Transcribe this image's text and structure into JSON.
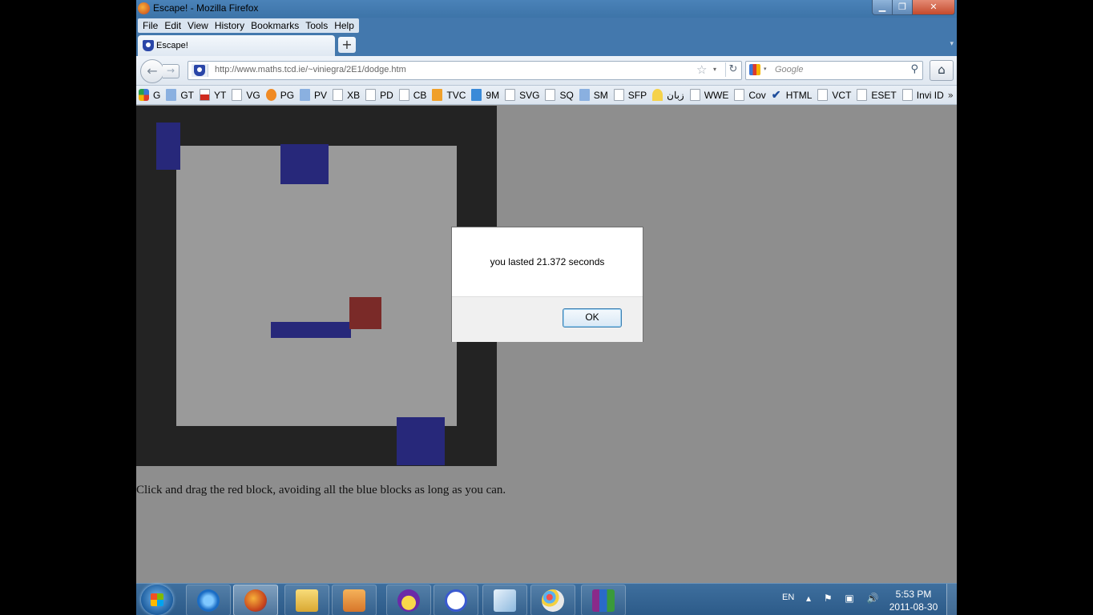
{
  "window": {
    "title": "Escape! - Mozilla Firefox",
    "controls": {
      "minimize": "▁",
      "maximize": "❐",
      "close": "✕"
    }
  },
  "menu": [
    "File",
    "Edit",
    "View",
    "History",
    "Bookmarks",
    "Tools",
    "Help"
  ],
  "tab": {
    "title": "Escape!",
    "new_tab": "+",
    "list": "▾"
  },
  "nav": {
    "back": "←",
    "forward": "→",
    "url": "http://www.maths.tcd.ie/~viniegra/2E1/dodge.htm",
    "star": "☆",
    "dropdown": "▾",
    "reload": "↻",
    "search_placeholder": "Google",
    "search_dropdown": "▾",
    "search_glyph": "⚲",
    "home": "⌂"
  },
  "bookmarks": [
    {
      "label": "G",
      "icon": "g"
    },
    {
      "label": "GT",
      "icon": "gt"
    },
    {
      "label": "YT",
      "icon": "yt"
    },
    {
      "label": "VG",
      "icon": "page"
    },
    {
      "label": "PG",
      "icon": "orange"
    },
    {
      "label": "PV",
      "icon": "gt"
    },
    {
      "label": "XB",
      "icon": "page"
    },
    {
      "label": "PD",
      "icon": "page"
    },
    {
      "label": "CB",
      "icon": "page"
    },
    {
      "label": "TVC",
      "icon": "tv"
    },
    {
      "label": "9M",
      "icon": "blue"
    },
    {
      "label": "SVG",
      "icon": "page"
    },
    {
      "label": "SQ",
      "icon": "page"
    },
    {
      "label": "SM",
      "icon": "gt"
    },
    {
      "label": "SFP",
      "icon": "page"
    },
    {
      "label": "زبان",
      "icon": "yellow"
    },
    {
      "label": "WWE",
      "icon": "page"
    },
    {
      "label": "Cov",
      "icon": "page"
    },
    {
      "label": "HTML",
      "icon": "check"
    },
    {
      "label": "VCT",
      "icon": "page"
    },
    {
      "label": "ESET",
      "icon": "page"
    },
    {
      "label": "Invi ID",
      "icon": "page"
    }
  ],
  "bookmarks_more": "»",
  "page": {
    "instructions": "Click and drag the red block, avoiding all the blue blocks as long as you can."
  },
  "dialog": {
    "message": "you lasted 21.372 seconds",
    "ok": "OK"
  },
  "taskbar": {
    "language": "EN",
    "tray_icons": "▴ ⚑ ▣ 🔊",
    "time": "5:53 PM",
    "date": "2011-08-30"
  },
  "colors": {
    "blue_block": "#27287a",
    "red_block": "#7a2a28",
    "board_border": "#232323",
    "arena": "#9a9a9a"
  }
}
